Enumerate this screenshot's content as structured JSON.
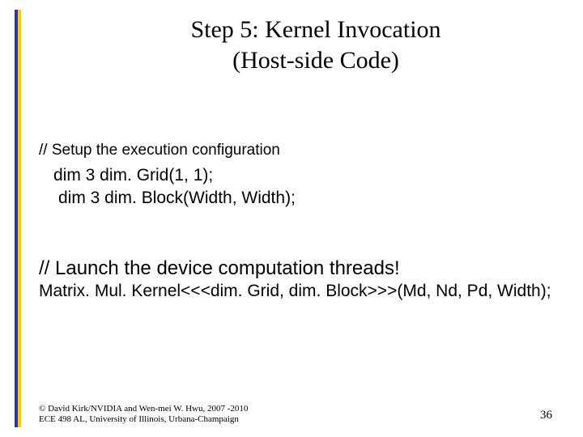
{
  "title": {
    "line1": "Step 5: Kernel Invocation",
    "line2": "(Host-side Code)"
  },
  "config": {
    "comment": "// Setup the execution configuration",
    "line1": "dim 3 dim. Grid(1, 1);",
    "line2": "dim 3 dim. Block(Width, Width);"
  },
  "launch": {
    "comment": "// Launch the device computation threads!",
    "call": "Matrix. Mul. Kernel<<<dim. Grid, dim. Block>>>(Md, Nd, Pd, Width);"
  },
  "footer": {
    "copyright_line1": "© David Kirk/NVIDIA and Wen-mei W. Hwu, 2007 -2010",
    "copyright_line2": "ECE 498 AL, University of Illinois, Urbana-Champaign",
    "page_number": "36"
  }
}
